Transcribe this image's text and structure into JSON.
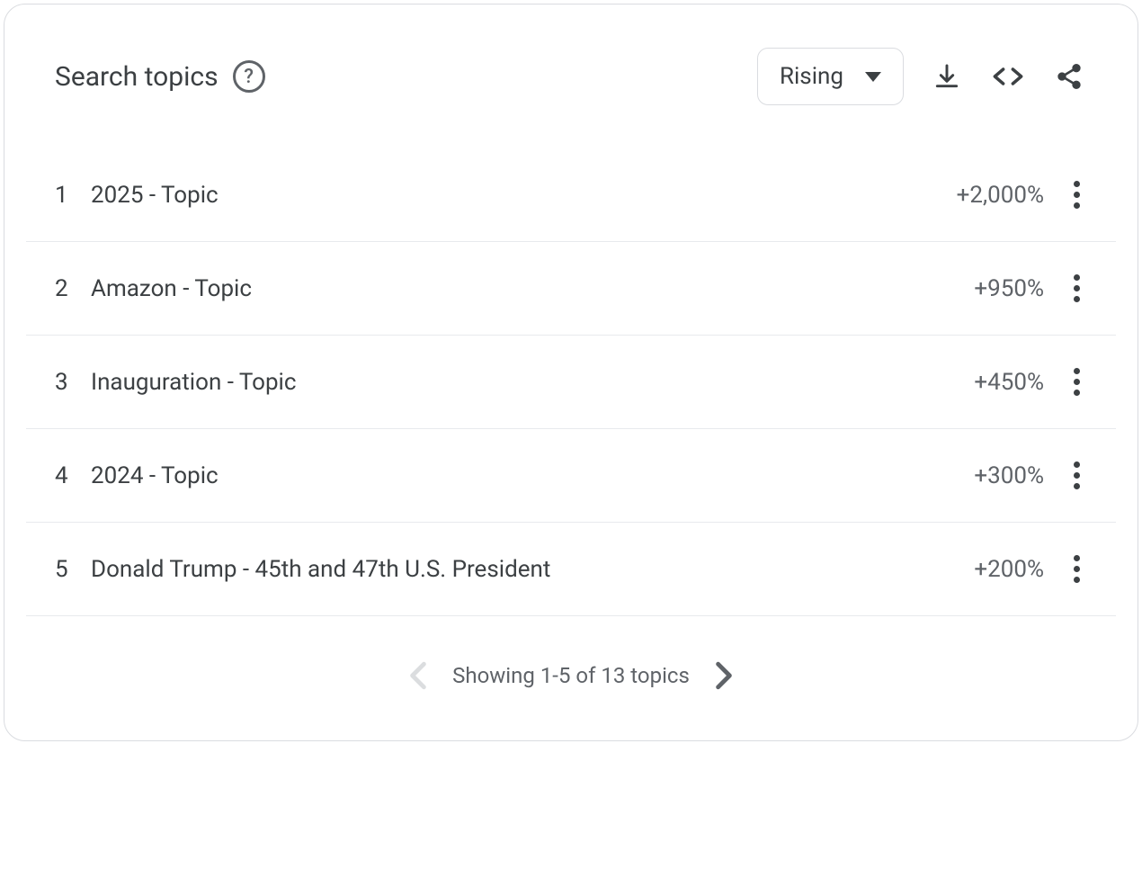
{
  "header": {
    "title": "Search topics",
    "select_label": "Rising"
  },
  "topics": [
    {
      "rank": "1",
      "label": "2025 - Topic",
      "value": "+2,000%"
    },
    {
      "rank": "2",
      "label": "Amazon - Topic",
      "value": "+950%"
    },
    {
      "rank": "3",
      "label": "Inauguration - Topic",
      "value": "+450%"
    },
    {
      "rank": "4",
      "label": "2024 - Topic",
      "value": "+300%"
    },
    {
      "rank": "5",
      "label": "Donald Trump - 45th and 47th U.S. President",
      "value": "+200%"
    }
  ],
  "pagination": {
    "text": "Showing 1-5 of 13 topics"
  }
}
